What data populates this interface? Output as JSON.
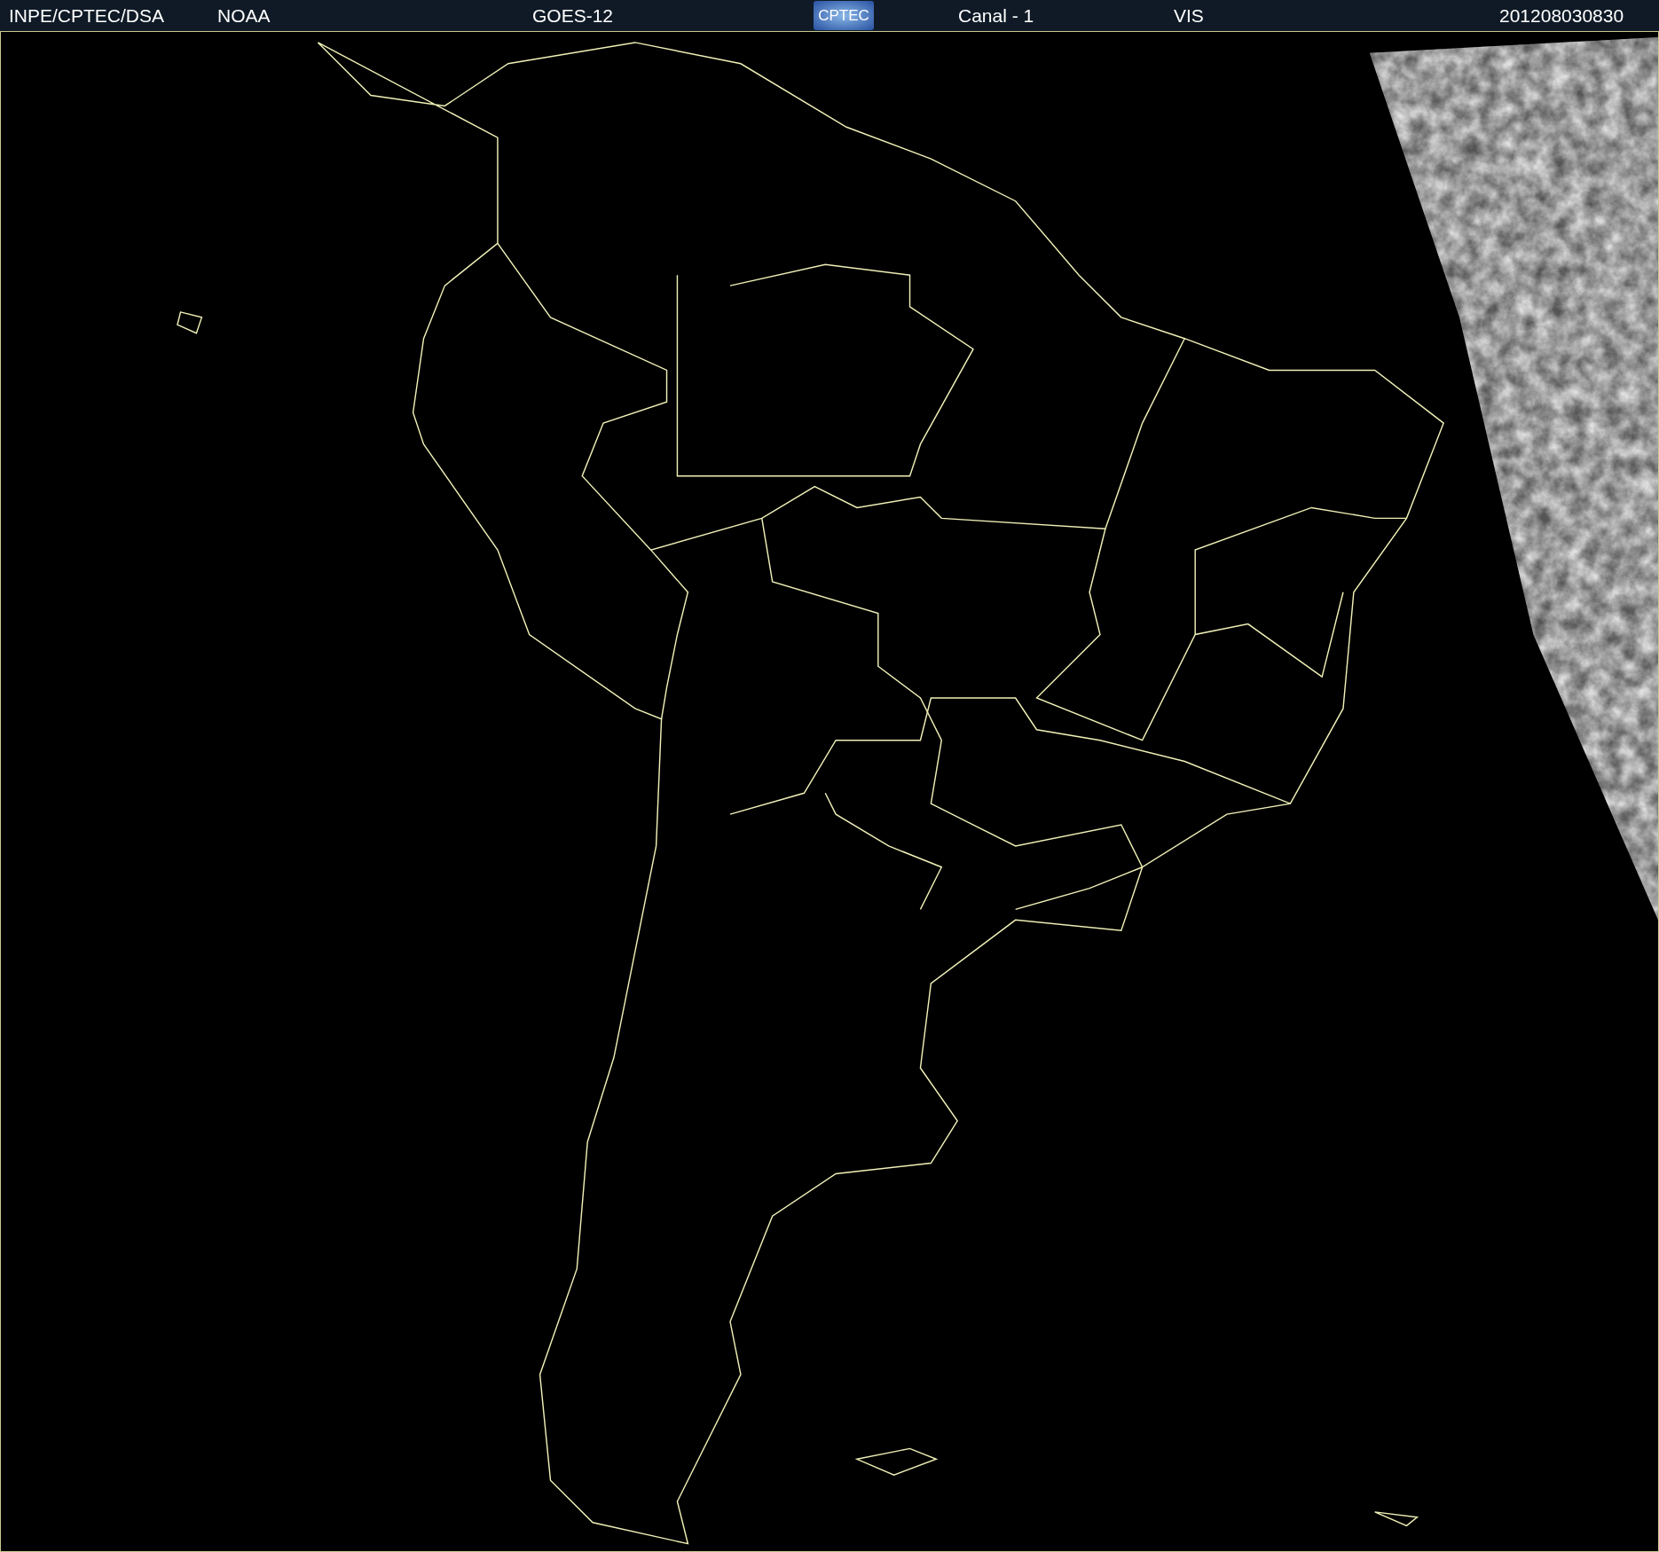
{
  "header": {
    "source": "INPE/CPTEC/DSA",
    "agency": "NOAA",
    "satellite": "GOES-12",
    "logo_text": "CPTEC",
    "channel": "Canal - 1",
    "band": "VIS",
    "timestamp": "201208030830"
  }
}
